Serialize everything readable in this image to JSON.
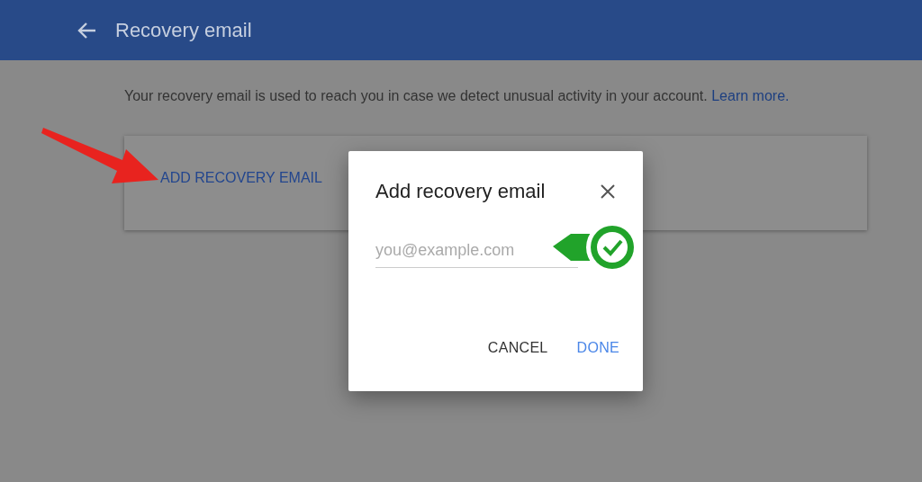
{
  "header": {
    "title": "Recovery email"
  },
  "description": {
    "text": "Your recovery email is used to reach you in case we detect unusual activity in your account.",
    "link": "Learn more."
  },
  "card": {
    "action": "ADD RECOVERY EMAIL"
  },
  "dialog": {
    "title": "Add recovery email",
    "email_field": {
      "placeholder": "you@example.com"
    },
    "buttons": [
      {
        "label": "CANCEL",
        "kind": "secondary"
      },
      {
        "label": "DONE",
        "kind": "primary"
      }
    ]
  }
}
